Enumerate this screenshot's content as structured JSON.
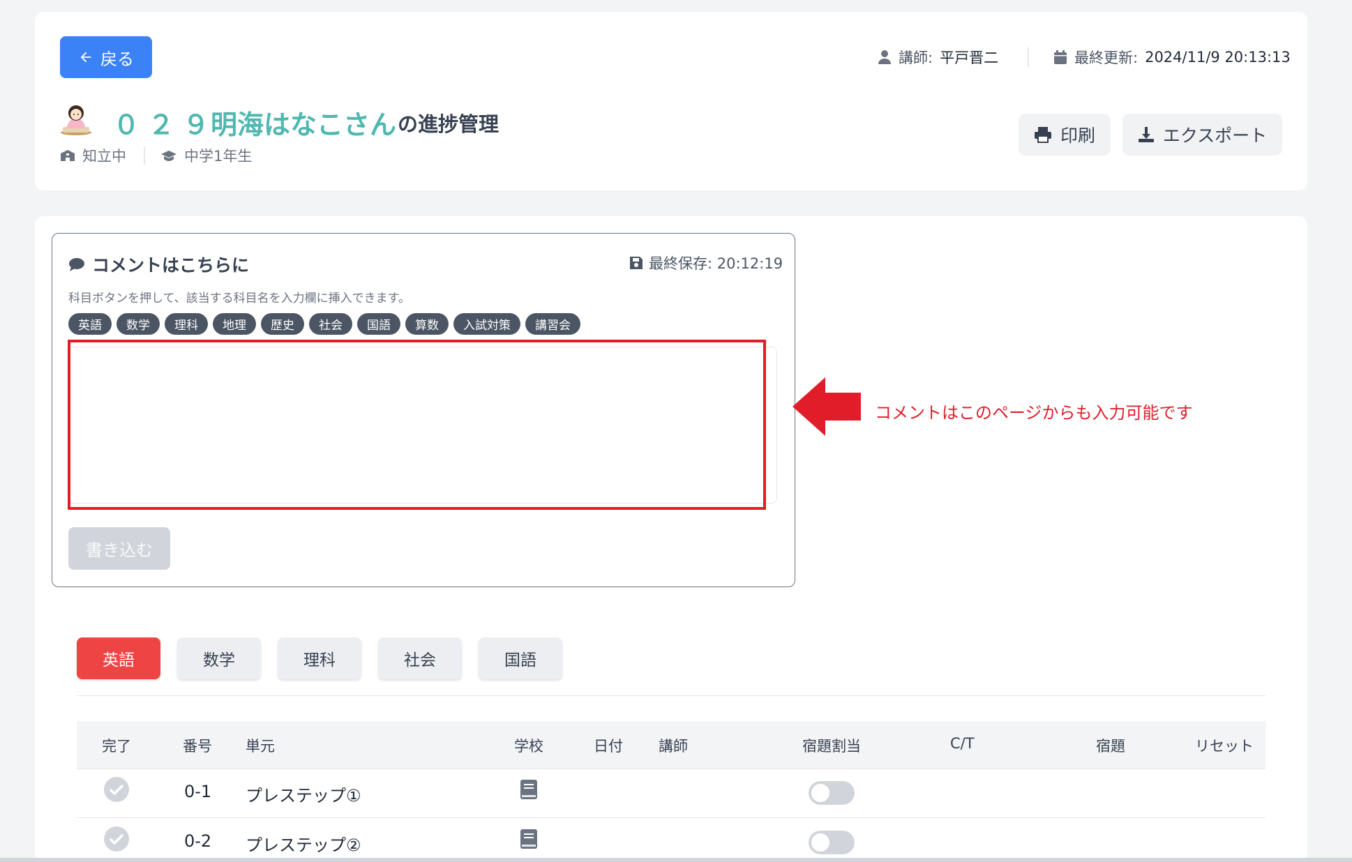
{
  "header": {
    "back_label": "戻る",
    "instructor_label": "講師:",
    "instructor_name": "平戸晋二",
    "updated_label": "最終更新:",
    "updated_value": "2024/11/9 20:13:13",
    "student_number": "０２９",
    "student_name": "明海はなこさん",
    "title_suffix": "の進捗管理",
    "school": "知立中",
    "grade": "中学1年生",
    "print_label": "印刷",
    "export_label": "エクスポート"
  },
  "comment": {
    "title": "コメントはこちらに",
    "saved_label": "最終保存: 20:12:19",
    "hint": "科目ボタンを押して、該当する科目名を入力欄に挿入できます。",
    "chips": [
      "英語",
      "数学",
      "理科",
      "地理",
      "歴史",
      "社会",
      "国語",
      "算数",
      "入試対策",
      "講習会"
    ],
    "textarea_value": "",
    "submit_label": "書き込む",
    "annotation": "コメントはこのページからも入力可能です"
  },
  "tabs": [
    {
      "label": "英語",
      "active": true
    },
    {
      "label": "数学",
      "active": false
    },
    {
      "label": "理科",
      "active": false
    },
    {
      "label": "社会",
      "active": false
    },
    {
      "label": "国語",
      "active": false
    }
  ],
  "table": {
    "headers": [
      "完了",
      "番号",
      "単元",
      "学校",
      "日付",
      "講師",
      "宿題割当",
      "C/T",
      "宿題",
      "リセット"
    ],
    "rows": [
      {
        "number": "0-1",
        "unit": "プレステップ①"
      },
      {
        "number": "0-2",
        "unit": "プレステップ②"
      }
    ]
  },
  "colors": {
    "primary": "#3b82f6",
    "accent_teal": "#4fb8b0",
    "active_tab": "#ef4444",
    "annotation_red": "#e11d2a"
  }
}
